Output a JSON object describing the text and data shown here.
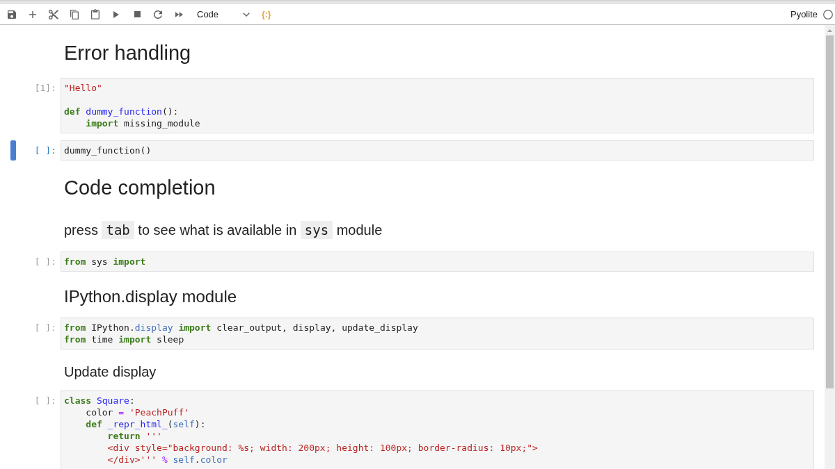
{
  "toolbar": {
    "cell_type": "Code",
    "format_button": "{:}",
    "kernel": {
      "name": "Pyolite",
      "busy": false
    }
  },
  "cells": [
    {
      "kind": "h1",
      "selected": false,
      "text": "Error handling"
    },
    {
      "kind": "code",
      "selected": false,
      "prompt": "[1]:",
      "lines": [
        {
          "kind": "code",
          "tokens": [
            {
              "kind": "string",
              "text": "\"Hello\""
            }
          ]
        },
        {
          "kind": "blank"
        },
        {
          "kind": "code",
          "tokens": [
            {
              "kind": "keyword",
              "text": "def"
            },
            {
              "kind": "def",
              "text": " dummy_function"
            },
            {
              "kind": "plain",
              "text": "():"
            }
          ]
        },
        {
          "kind": "code",
          "tokens": [
            {
              "kind": "keyword",
              "text": "    import"
            },
            {
              "kind": "plain",
              "text": " missing_module"
            }
          ]
        }
      ]
    },
    {
      "kind": "code",
      "selected": true,
      "prompt": "[ ]:",
      "lines": [
        {
          "kind": "code",
          "tokens": [
            {
              "kind": "plain",
              "text": "dummy_function()"
            }
          ]
        }
      ]
    },
    {
      "kind": "h1",
      "selected": false,
      "text": "Code completion"
    },
    {
      "kind": "h3",
      "selected": false,
      "parts": [
        {
          "kind": "text",
          "text": "press "
        },
        {
          "kind": "code",
          "text": "tab"
        },
        {
          "kind": "text",
          "text": " to see what is available in "
        },
        {
          "kind": "code",
          "text": "sys"
        },
        {
          "kind": "text",
          "text": " module"
        }
      ]
    },
    {
      "kind": "code",
      "selected": false,
      "prompt": "[ ]:",
      "lines": [
        {
          "kind": "code",
          "tokens": [
            {
              "kind": "keyword",
              "text": "from"
            },
            {
              "kind": "plain",
              "text": " sys "
            },
            {
              "kind": "keyword",
              "text": "import"
            }
          ]
        }
      ]
    },
    {
      "kind": "h2",
      "selected": false,
      "text": "IPython.display module"
    },
    {
      "kind": "code",
      "selected": false,
      "prompt": "[ ]:",
      "lines": [
        {
          "kind": "code",
          "tokens": [
            {
              "kind": "keyword",
              "text": "from"
            },
            {
              "kind": "plain",
              "text": " IPython."
            },
            {
              "kind": "property",
              "text": "display"
            },
            {
              "kind": "keyword",
              "text": " import"
            },
            {
              "kind": "plain",
              "text": " clear_output, display, update_display"
            }
          ]
        },
        {
          "kind": "code",
          "tokens": [
            {
              "kind": "keyword",
              "text": "from"
            },
            {
              "kind": "plain",
              "text": " time "
            },
            {
              "kind": "keyword",
              "text": "import"
            },
            {
              "kind": "plain",
              "text": " sleep"
            }
          ]
        }
      ]
    },
    {
      "kind": "h4",
      "selected": false,
      "text": "Update display"
    },
    {
      "kind": "code",
      "selected": false,
      "prompt": "[ ]:",
      "lines": [
        {
          "kind": "code",
          "tokens": [
            {
              "kind": "keyword",
              "text": "class"
            },
            {
              "kind": "def",
              "text": " Square"
            },
            {
              "kind": "plain",
              "text": ":"
            }
          ]
        },
        {
          "kind": "code",
          "tokens": [
            {
              "kind": "plain",
              "text": "    color "
            },
            {
              "kind": "operator",
              "text": "="
            },
            {
              "kind": "string",
              "text": " 'PeachPuff'"
            }
          ]
        },
        {
          "kind": "code",
          "tokens": [
            {
              "kind": "keyword",
              "text": "    def"
            },
            {
              "kind": "def",
              "text": " _repr_html_"
            },
            {
              "kind": "plain",
              "text": "("
            },
            {
              "kind": "variable",
              "text": "self"
            },
            {
              "kind": "plain",
              "text": "):"
            }
          ]
        },
        {
          "kind": "code",
          "tokens": [
            {
              "kind": "keyword",
              "text": "        return"
            },
            {
              "kind": "string",
              "text": " '''"
            }
          ]
        },
        {
          "kind": "code",
          "tokens": [
            {
              "kind": "string",
              "text": "        <div style=\"background: %s; width: 200px; height: 100px; border-radius: 10px;\">"
            }
          ]
        },
        {
          "kind": "code",
          "tokens": [
            {
              "kind": "string",
              "text": "        </div>'''"
            },
            {
              "kind": "operator",
              "text": " %"
            },
            {
              "kind": "variable",
              "text": " self"
            },
            {
              "kind": "plain",
              "text": "."
            },
            {
              "kind": "property",
              "text": "color"
            }
          ]
        }
      ]
    }
  ]
}
